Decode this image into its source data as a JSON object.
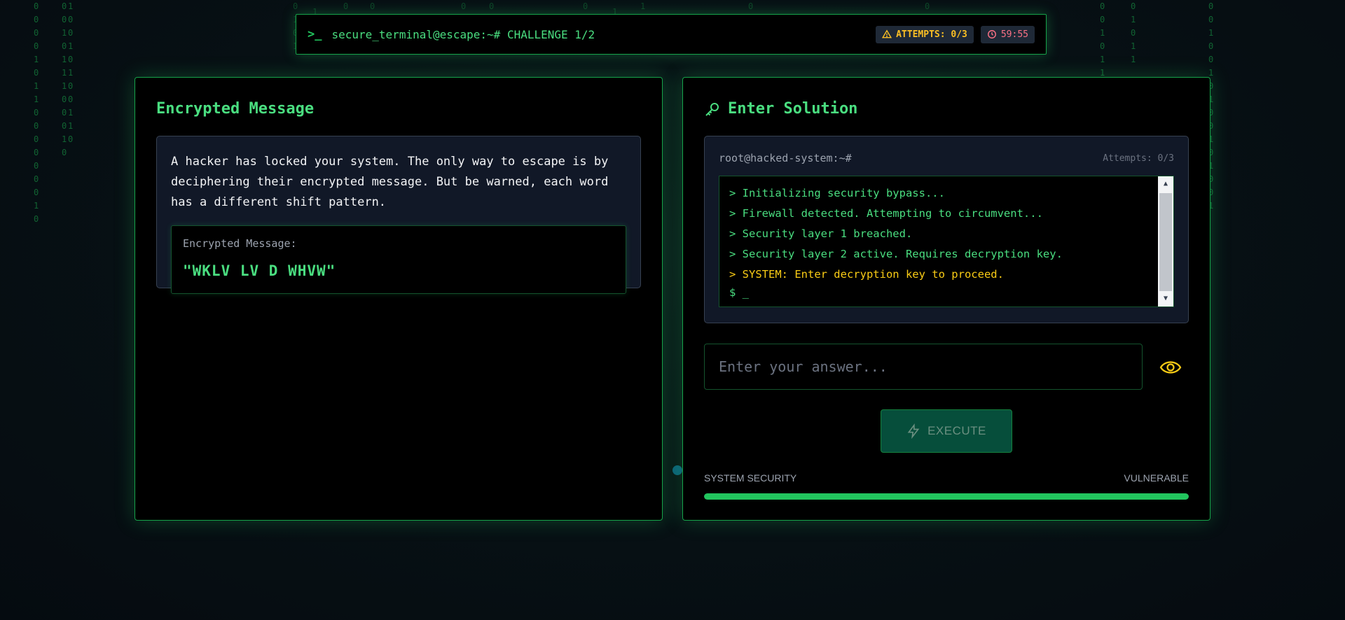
{
  "header": {
    "title": "secure_terminal@escape:~# CHALLENGE 1/2",
    "attempts_badge": "ATTEMPTS: 0/3",
    "timer": "59:55"
  },
  "left_panel": {
    "heading": "Encrypted Message",
    "story": "A hacker has locked your system. The only way to escape is by deciphering their encrypted message. But be warned, each word has a different shift pattern.",
    "cipher_label": "Encrypted Message:",
    "cipher_text": "\"WKLV LV D WHVW\""
  },
  "right_panel": {
    "heading": "Enter Solution",
    "terminal": {
      "host": "root@hacked-system:~#",
      "attempts": "Attempts: 0/3",
      "lines": [
        "> Initializing security bypass...",
        "> Firewall detected. Attempting to circumvent...",
        "> Security layer 1 breached.",
        "> Security layer 2 active. Requires decryption key.",
        "> SYSTEM: Enter decryption key to proceed."
      ],
      "cursor": "$ _"
    },
    "answer_placeholder": "Enter your answer...",
    "execute_label": "EXECUTE",
    "security_label": "SYSTEM SECURITY",
    "security_status": "VULNERABLE",
    "security_level_percent": 100
  },
  "colors": {
    "accent": "#22c55e",
    "warning": "#facc15",
    "timer": "#fb7185"
  },
  "icons": {
    "header": "terminal-prompt-icon",
    "attempts": "warning-triangle-icon",
    "timer": "clock-icon",
    "solution": "key-icon",
    "reveal": "eye-icon",
    "execute": "lightning-icon"
  }
}
